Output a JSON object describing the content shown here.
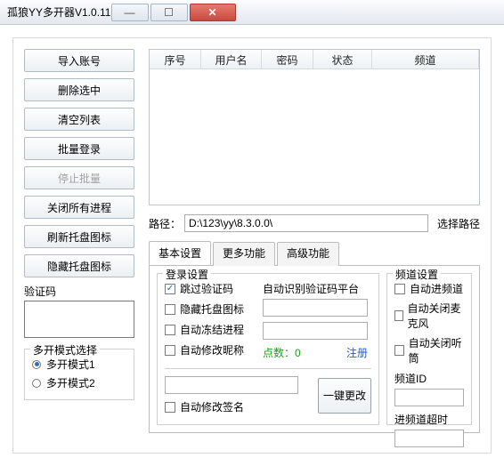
{
  "titlebar": {
    "title": "孤狼YY多开器V1.0.11"
  },
  "sidebar": {
    "buttons": [
      {
        "label": "导入账号",
        "disabled": false
      },
      {
        "label": "删除选中",
        "disabled": false
      },
      {
        "label": "清空列表",
        "disabled": false
      },
      {
        "label": "批量登录",
        "disabled": false
      },
      {
        "label": "停止批量",
        "disabled": true
      },
      {
        "label": "关闭所有进程",
        "disabled": false
      },
      {
        "label": "刷新托盘图标",
        "disabled": false
      },
      {
        "label": "隐藏托盘图标",
        "disabled": false
      }
    ],
    "verify_label": "验证码",
    "mode_group": {
      "legend": "多开模式选择",
      "options": [
        {
          "label": "多开模式1",
          "selected": true
        },
        {
          "label": "多开模式2",
          "selected": false
        }
      ]
    }
  },
  "table": {
    "columns": [
      "序号",
      "用户名",
      "密码",
      "状态",
      "频道"
    ]
  },
  "path": {
    "label": "路径：",
    "value": "D:\\123\\yy\\8.3.0.0\\",
    "choose": "选择路径"
  },
  "tabs": {
    "items": [
      "基本设置",
      "更多功能",
      "高级功能"
    ],
    "active": 0
  },
  "login_group": {
    "legend": "登录设置",
    "skip_verify": "跳过验证码",
    "hide_tray": "隐藏托盘图标",
    "freeze_proc": "自动冻结进程",
    "modify_nick": "自动修改昵称",
    "modify_sign": "自动修改签名",
    "platform_label": "自动识别验证码平台",
    "points_label": "点数：",
    "points_value": "0",
    "register": "注册",
    "apply_btn": "一键更改",
    "skip_verify_checked": true
  },
  "channel_group": {
    "legend": "频道设置",
    "auto_channel": "自动进频道",
    "auto_mic": "自动关闭麦克风",
    "auto_speaker": "自动关闭听筒",
    "channel_id_label": "频道ID",
    "channel_timeout_label": "进频道超时"
  }
}
